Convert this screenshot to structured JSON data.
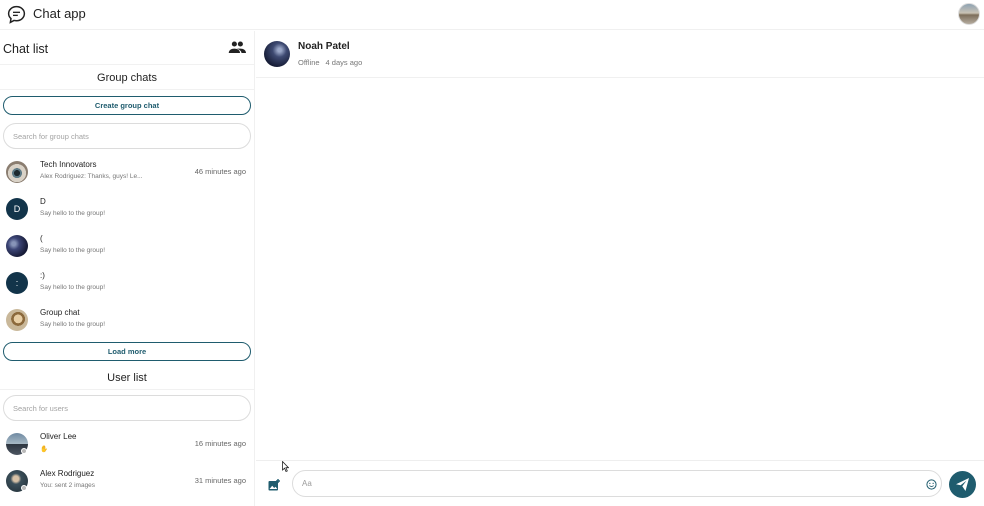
{
  "app": {
    "title": "Chat app"
  },
  "colors": {
    "primary": "#1f5c6e",
    "avatar_letter_bg": "#12344a",
    "offline_dot": "#b9b9b9"
  },
  "icons": {
    "app_logo": "chat-bubble-icon",
    "people": "people-icon",
    "attach": "image-add-icon",
    "emoji": "smiley-icon",
    "send": "send-icon"
  },
  "sidebar": {
    "title": "Chat list",
    "group_section": {
      "title": "Group chats",
      "create_label": "Create group chat",
      "search_placeholder": "Search for group chats",
      "load_more_label": "Load more",
      "items": [
        {
          "name": "Tech Innovators",
          "preview": "Alex Rodriguez: Thanks, guys! Le...",
          "time": "46 minutes ago",
          "avatar": "eye-photo"
        },
        {
          "name": "D",
          "preview": "Say hello to the group!",
          "avatar_letter": "D"
        },
        {
          "name": "(",
          "preview": "Say hello to the group!",
          "avatar": "space-photo"
        },
        {
          "name": ":)",
          "preview": "Say hello to the group!",
          "avatar_letter": ":"
        },
        {
          "name": "Group chat",
          "preview": "Say hello to the group!",
          "avatar": "cartoon-photo"
        }
      ]
    },
    "user_section": {
      "title": "User list",
      "search_placeholder": "Search for users",
      "items": [
        {
          "name": "Oliver Lee",
          "preview": "✋",
          "time": "16 minutes ago",
          "status": "offline"
        },
        {
          "name": "Alex Rodriguez",
          "preview": "You: sent 2 images",
          "time": "31 minutes ago",
          "status": "offline"
        }
      ]
    }
  },
  "chat": {
    "contact_name": "Noah Patel",
    "status": "Offline",
    "last_seen": "4 days ago",
    "input_placeholder": "Aa"
  }
}
